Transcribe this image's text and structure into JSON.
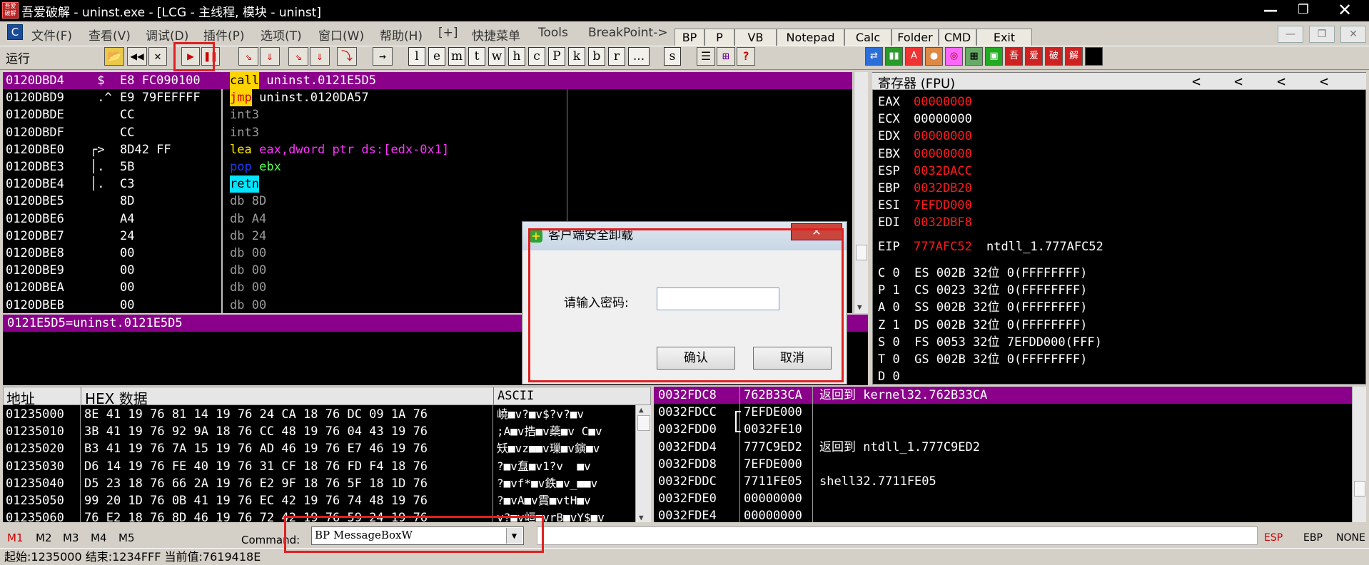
{
  "window": {
    "title": "吾爱破解 - uninst.exe - [LCG - 主线程, 模块 - uninst]",
    "logo_text": "吾爱破解"
  },
  "menu": [
    {
      "label": "文件(F)"
    },
    {
      "label": "查看(V)"
    },
    {
      "label": "调试(D)"
    },
    {
      "label": "插件(P)"
    },
    {
      "label": "选项(T)"
    },
    {
      "label": "窗口(W)"
    },
    {
      "label": "帮助(H)"
    },
    {
      "label": "[+]"
    },
    {
      "label": "快捷菜单"
    },
    {
      "label": "Tools"
    },
    {
      "label": "BreakPoint->"
    }
  ],
  "plugin_buttons": [
    {
      "label": "BP"
    },
    {
      "label": "P"
    },
    {
      "label": "VB"
    },
    {
      "label": "Notepad"
    },
    {
      "label": "Calc"
    },
    {
      "label": "Folder"
    },
    {
      "label": "CMD"
    },
    {
      "label": "Exit"
    }
  ],
  "toolbar": {
    "status": "运行",
    "letters": [
      "l",
      "e",
      "m",
      "t",
      "w",
      "h",
      "c",
      "P",
      "k",
      "b",
      "r",
      "...",
      "s"
    ],
    "color_icons": [
      "吾",
      "爱",
      "破",
      "解"
    ]
  },
  "disasm": {
    "rows": [
      {
        "addr": "0120DBD4",
        "flag": " $ ",
        "bytes": "E8 FC090100",
        "instr": "call",
        "args": " uninst.0121E5D5"
      },
      {
        "addr": "0120DBD9",
        "flag": " .^",
        "bytes": "E9 79FEFFFF",
        "instr": "jmp",
        "args": " uninst.0120DA57"
      },
      {
        "addr": "0120DBDE",
        "flag": "   ",
        "bytes": "CC",
        "instr": "int3",
        "args": ""
      },
      {
        "addr": "0120DBDF",
        "flag": "   ",
        "bytes": "CC",
        "instr": "int3",
        "args": ""
      },
      {
        "addr": "0120DBE0",
        "flag": "┌> ",
        "bytes": "8D42 FF",
        "instr": "lea",
        "args": " eax,dword ptr ds:[edx-0x1]"
      },
      {
        "addr": "0120DBE3",
        "flag": "│. ",
        "bytes": "5B",
        "instr": "pop",
        "args": " ebx"
      },
      {
        "addr": "0120DBE4",
        "flag": "│. ",
        "bytes": "C3",
        "instr": "retn",
        "args": ""
      },
      {
        "addr": "0120DBE5",
        "flag": "   ",
        "bytes": "8D",
        "instr": "db 8D",
        "args": ""
      },
      {
        "addr": "0120DBE6",
        "flag": "   ",
        "bytes": "A4",
        "instr": "db A4",
        "args": ""
      },
      {
        "addr": "0120DBE7",
        "flag": "   ",
        "bytes": "24",
        "instr": "db 24",
        "args": ""
      },
      {
        "addr": "0120DBE8",
        "flag": "   ",
        "bytes": "00",
        "instr": "db 00",
        "args": ""
      },
      {
        "addr": "0120DBE9",
        "flag": "   ",
        "bytes": "00",
        "instr": "db 00",
        "args": ""
      },
      {
        "addr": "0120DBEA",
        "flag": "   ",
        "bytes": "00",
        "instr": "db 00",
        "args": ""
      },
      {
        "addr": "0120DBEB",
        "flag": "   ",
        "bytes": "00",
        "instr": "db 00",
        "args": ""
      }
    ],
    "info": "0121E5D5=uninst.0121E5D5"
  },
  "registers": {
    "header": "寄存器 (FPU)",
    "nav": [
      "<",
      "<",
      "<",
      "<"
    ],
    "gp": [
      {
        "name": "EAX",
        "value": "00000000",
        "note": ""
      },
      {
        "name": "ECX",
        "value": "00000000",
        "note": ""
      },
      {
        "name": "EDX",
        "value": "00000000",
        "note": ""
      },
      {
        "name": "EBX",
        "value": "00000000",
        "note": ""
      },
      {
        "name": "ESP",
        "value": "0032DACC",
        "note": ""
      },
      {
        "name": "EBP",
        "value": "0032DB20",
        "note": ""
      },
      {
        "name": "ESI",
        "value": "7EFDD000",
        "note": ""
      },
      {
        "name": "EDI",
        "value": "0032DBF8",
        "note": ""
      }
    ],
    "eip": {
      "name": "EIP",
      "value": "777AFC52",
      "note": "ntdll_1.777AFC52"
    },
    "flags": [
      "C 0  ES 002B 32位 0(FFFFFFFF)",
      "P 1  CS 0023 32位 0(FFFFFFFF)",
      "A 0  SS 002B 32位 0(FFFFFFFF)",
      "Z 1  DS 002B 32位 0(FFFFFFFF)",
      "S 0  FS 0053 32位 7EFDD000(FFF)",
      "T 0  GS 002B 32位 0(FFFFFFFF)",
      "D 0"
    ]
  },
  "dump": {
    "headers": {
      "addr": "地址",
      "hex": "HEX 数据",
      "ascii": "ASCII"
    },
    "rows": [
      {
        "addr": "01235000",
        "hex": "8E 41 19 76 81 14 19 76 24 CA 18 76 DC 09 1A 76",
        "ascii": "嶢■v?■v$?v?■v"
      },
      {
        "addr": "01235010",
        "hex": "3B 41 19 76 92 9A 18 76 CC 48 19 76 04 43 19 76",
        "ascii": ";A■v捁■v蘃■v C■v"
      },
      {
        "addr": "01235020",
        "hex": "B3 41 19 76 7A 15 19 76 AD 46 19 76 E7 46 19 76",
        "ascii": "矨■vz■■v璅■v鏔■v"
      },
      {
        "addr": "01235030",
        "hex": "D6 14 19 76 FE 40 19 76 31 CF 18 76 FD F4 18 76",
        "ascii": "?■v䀁■v1?v  ■v"
      },
      {
        "addr": "01235040",
        "hex": "D5 23 18 76 66 2A 19 76 E2 9F 18 76 5F 18 1D 76",
        "ascii": "?■vf*■v鉄■v_■■v"
      },
      {
        "addr": "01235050",
        "hex": "99 20 1D 76 0B 41 19 76 EC 42 19 76 74 48 19 76",
        "ascii": "?■vA■v霣■vtH■v"
      },
      {
        "addr": "01235060",
        "hex": "76 E2 18 76 8D 46 19 76 72 42 19 76 59 24 19 76",
        "ascii": "v?■v峘■vrB■vY$■v"
      }
    ]
  },
  "stack": {
    "rows": [
      {
        "addr": "0032FDC8",
        "val": "762B33CA",
        "comment": "返回到 kernel32.762B33CA"
      },
      {
        "addr": "0032FDCC",
        "val": "7EFDE000",
        "comment": ""
      },
      {
        "addr": "0032FDD0",
        "val": "0032FE10",
        "comment": ""
      },
      {
        "addr": "0032FDD4",
        "val": "777C9ED2",
        "comment": "返回到 ntdll_1.777C9ED2"
      },
      {
        "addr": "0032FDD8",
        "val": "7EFDE000",
        "comment": ""
      },
      {
        "addr": "0032FDDC",
        "val": "7711FE05",
        "comment": "shell32.7711FE05"
      },
      {
        "addr": "0032FDE0",
        "val": "00000000",
        "comment": ""
      },
      {
        "addr": "0032FDE4",
        "val": "00000000",
        "comment": ""
      }
    ]
  },
  "dialog": {
    "title": "客户端安全卸载",
    "label": "请输入密码:",
    "password_value": "",
    "ok": "确认",
    "cancel": "取消",
    "close": "✕"
  },
  "command_bar": {
    "m_buttons": [
      "M1",
      "M2",
      "M3",
      "M4",
      "M5"
    ],
    "label": "Command:",
    "value": "BP MessageBoxW",
    "right": [
      "ESP",
      "EBP",
      "NONE"
    ]
  },
  "statusbar": {
    "text": "起始:1235000 结束:1234FFF 当前值:7619418E"
  },
  "colors": {
    "selection": "#8b008b",
    "register_changed": "#ff1a1a",
    "annotation_box": "#e02020"
  }
}
